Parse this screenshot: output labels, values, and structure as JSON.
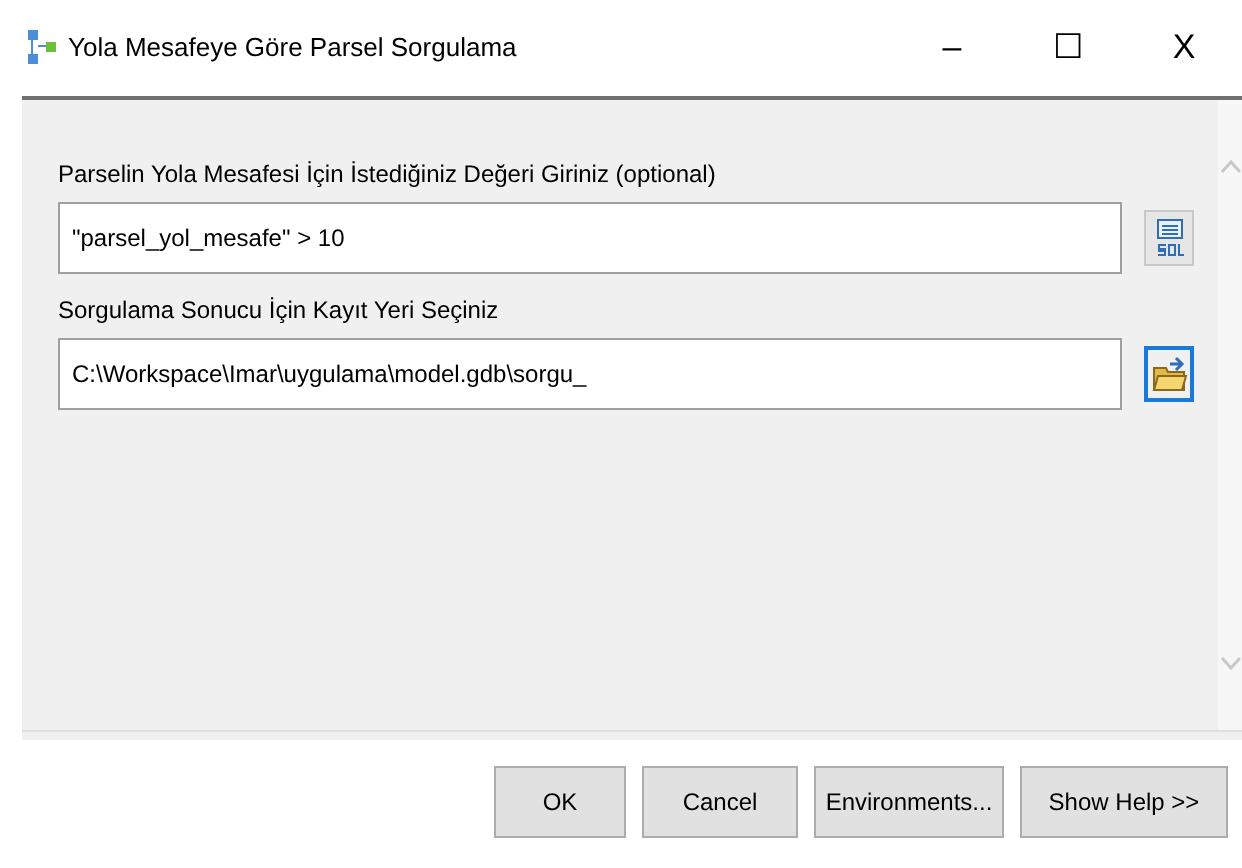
{
  "window": {
    "title": "Yola Mesafeye Göre Parsel Sorgulama",
    "controls": [
      "–",
      "☐",
      "X"
    ]
  },
  "parameters": [
    {
      "kind": "sql",
      "label": "Parselin Yola Mesafesi İçin İstediğiniz Değeri Giriniz (optional)",
      "value": "\"parsel_yol_mesafe\" > 10",
      "focused": false
    },
    {
      "kind": "folder",
      "label": "Sorgulama Sonucu İçin Kayıt Yeri Seçiniz",
      "value": "C:\\Workspace\\Imar\\uygulama\\model.gdb\\sorgu_",
      "focused": true
    }
  ],
  "buttons": [
    "OK",
    "Cancel",
    "Environments...",
    "Show Help >>"
  ]
}
